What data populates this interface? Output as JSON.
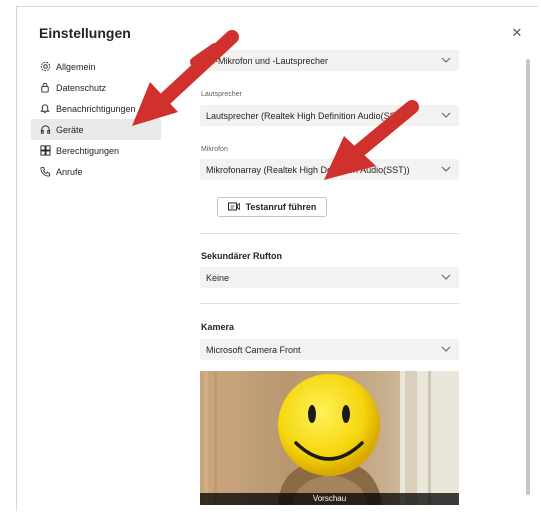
{
  "window": {
    "title": "Einstellungen"
  },
  "sidebar": {
    "items": [
      {
        "label": "Allgemein",
        "icon": "gear-icon"
      },
      {
        "label": "Datenschutz",
        "icon": "lock-icon"
      },
      {
        "label": "Benachrichtigungen",
        "icon": "bell-icon"
      },
      {
        "label": "Geräte",
        "icon": "headset-icon",
        "active": true
      },
      {
        "label": "Berechtigungen",
        "icon": "grid-icon"
      },
      {
        "label": "Anrufe",
        "icon": "phone-icon"
      }
    ]
  },
  "devices": {
    "audio_device": "…-Mikrofon und -Lautsprecher",
    "speaker_label": "Lautsprecher",
    "speaker_value": "Lautsprecher (Realtek High Definition Audio(SST))",
    "mic_label": "Mikrofon",
    "mic_value": "Mikrofonarray (Realtek High Definition Audio(SST))",
    "test_call_label": "Testanruf führen"
  },
  "secondary_ringtone": {
    "heading": "Sekundärer Rufton",
    "value": "Keine"
  },
  "camera": {
    "heading": "Kamera",
    "value": "Microsoft Camera Front",
    "preview_label": "Vorschau"
  },
  "colors": {
    "annotation_arrow": "#d0312d",
    "active_nav_bg": "#e9e9e9",
    "select_bg": "#f3f2f1"
  }
}
